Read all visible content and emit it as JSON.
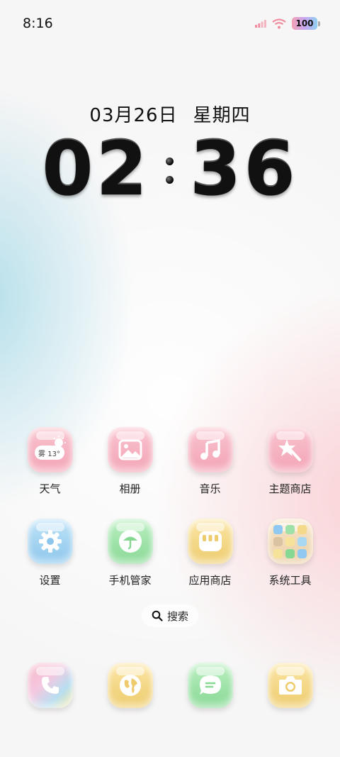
{
  "status_bar": {
    "time": "8:16",
    "battery": "100"
  },
  "lockscreen": {
    "date": "03月26日",
    "weekday": "星期四",
    "hours": "02",
    "minutes": "36"
  },
  "apps": {
    "row1": [
      {
        "label": "天气",
        "icon": "weather-icon",
        "chip": "雾 13°"
      },
      {
        "label": "相册",
        "icon": "photo-icon"
      },
      {
        "label": "音乐",
        "icon": "music-icon"
      },
      {
        "label": "主题商店",
        "icon": "theme-store-icon"
      }
    ],
    "row2": [
      {
        "label": "设置",
        "icon": "gear-icon"
      },
      {
        "label": "手机管家",
        "icon": "umbrella-icon"
      },
      {
        "label": "应用商店",
        "icon": "store-icon"
      },
      {
        "label": "系统工具",
        "icon": "folder-icon"
      }
    ]
  },
  "search": {
    "label": "搜索"
  },
  "dock": [
    {
      "icon": "phone-icon"
    },
    {
      "icon": "browser-icon"
    },
    {
      "icon": "message-icon"
    },
    {
      "icon": "camera-icon"
    }
  ],
  "colors": {
    "pink": "#f3a3b4",
    "blue": "#8cc6ec",
    "green": "#86d893",
    "yellow": "#eecb6c"
  }
}
